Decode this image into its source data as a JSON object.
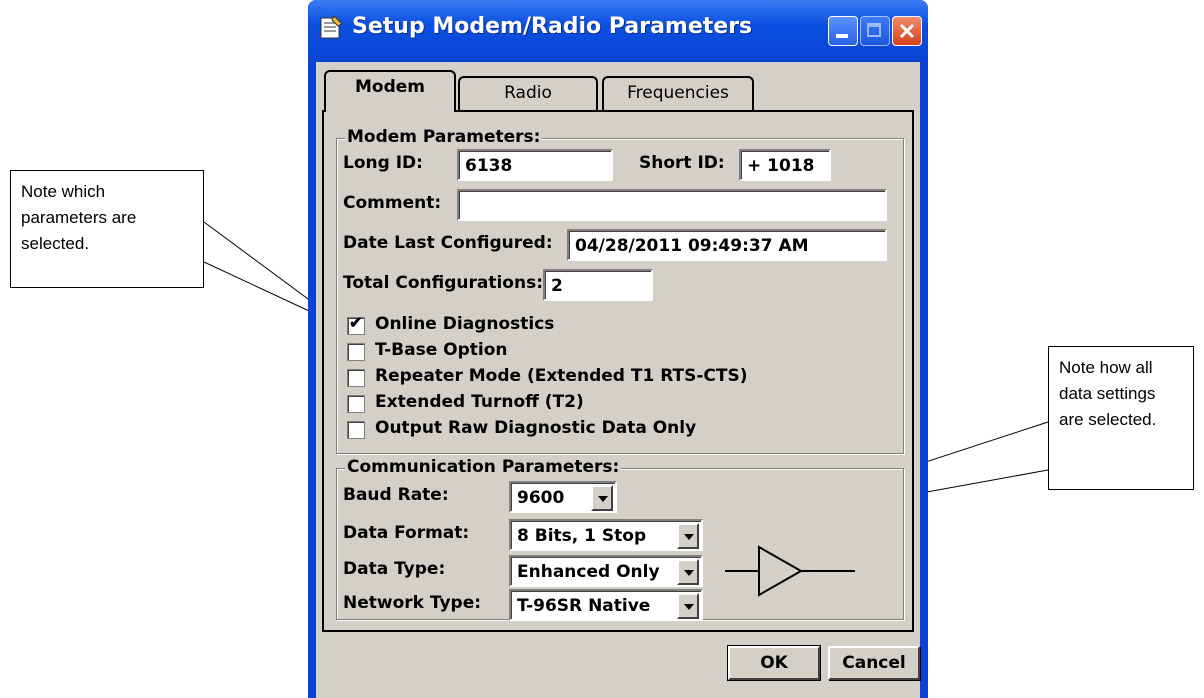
{
  "window": {
    "title": "Setup Modem/Radio Parameters"
  },
  "tabs": [
    {
      "label": "Modem",
      "selected": true
    },
    {
      "label": "Radio",
      "selected": false
    },
    {
      "label": "Frequencies",
      "selected": false
    }
  ],
  "modem_parameters": {
    "legend": "Modem Parameters:",
    "long_id_label": "Long ID:",
    "long_id_value": "6138",
    "short_id_label": "Short ID:",
    "short_id_value": "+ 1018",
    "comment_label": "Comment:",
    "comment_value": "",
    "date_label": "Date Last Configured:",
    "date_value": "04/28/2011 09:49:37 AM",
    "total_label": "Total Configurations:",
    "total_value": "2",
    "options": [
      {
        "label": "Online Diagnostics",
        "checked": true
      },
      {
        "label": "T-Base Option",
        "checked": false
      },
      {
        "label": "Repeater Mode (Extended T1 RTS-CTS)",
        "checked": false
      },
      {
        "label": "Extended Turnoff (T2)",
        "checked": false
      },
      {
        "label": "Output Raw Diagnostic Data Only",
        "checked": false
      }
    ]
  },
  "communication_parameters": {
    "legend": "Communication Parameters:",
    "baud_rate_label": "Baud Rate:",
    "baud_rate_value": "9600",
    "data_format_label": "Data Format:",
    "data_format_value": "8 Bits, 1 Stop",
    "data_type_label": "Data Type:",
    "data_type_value": "Enhanced Only",
    "network_type_label": "Network Type:",
    "network_type_value": "T-96SR Native"
  },
  "buttons": {
    "ok": "OK",
    "cancel": "Cancel"
  },
  "callouts": {
    "left": "Note which parameters are selected.",
    "right": "Note how all data settings are selected."
  },
  "colors": {
    "titlebar": "#0a4fe0",
    "dialog_face": "#d4d0c8",
    "close_button": "#d6401a"
  },
  "icons": [
    "app-icon",
    "minimize-icon",
    "maximize-icon",
    "close-icon",
    "chevron-down-icon",
    "amplifier-symbol"
  ]
}
